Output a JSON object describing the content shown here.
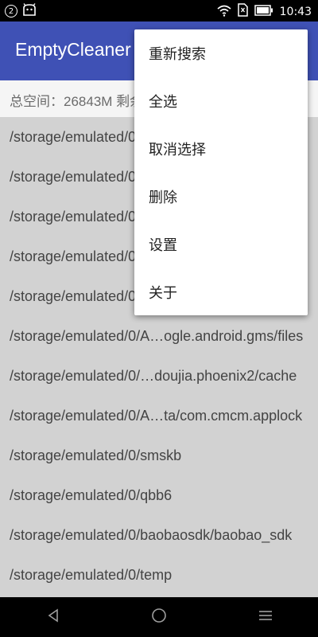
{
  "status_bar": {
    "notification_badge": "2",
    "time": "10:43"
  },
  "app_bar": {
    "title": "EmptyCleaner"
  },
  "summary": {
    "text": "总空间：26843M  剩余"
  },
  "list": {
    "rows": [
      "/storage/emulated/0",
      "/storage/emulated/0",
      "/storage/emulated/0",
      "/storage/emulated/0",
      "/storage/emulated/0",
      "/storage/emulated/0/A…ogle.android.gms/files",
      "/storage/emulated/0/…doujia.phoenix2/cache",
      "/storage/emulated/0/A…ta/com.cmcm.applock",
      "/storage/emulated/0/smskb",
      "/storage/emulated/0/qbb6",
      "/storage/emulated/0/baobaosdk/baobao_sdk",
      "/storage/emulated/0/temp"
    ]
  },
  "overflow_menu": {
    "items": [
      "重新搜索",
      "全选",
      "取消选择",
      "删除",
      "设置",
      "关于"
    ]
  },
  "colors": {
    "app_bar": "#3f51b5",
    "list_background": "#d2d2d2",
    "summary_background": "#f5f5f5"
  },
  "icons": {
    "status_left": [
      "notification-badge-icon",
      "android-icon"
    ],
    "status_right": [
      "wifi-icon",
      "sim-icon",
      "battery-icon"
    ],
    "nav": [
      "back-icon",
      "home-icon",
      "recents-icon"
    ]
  }
}
